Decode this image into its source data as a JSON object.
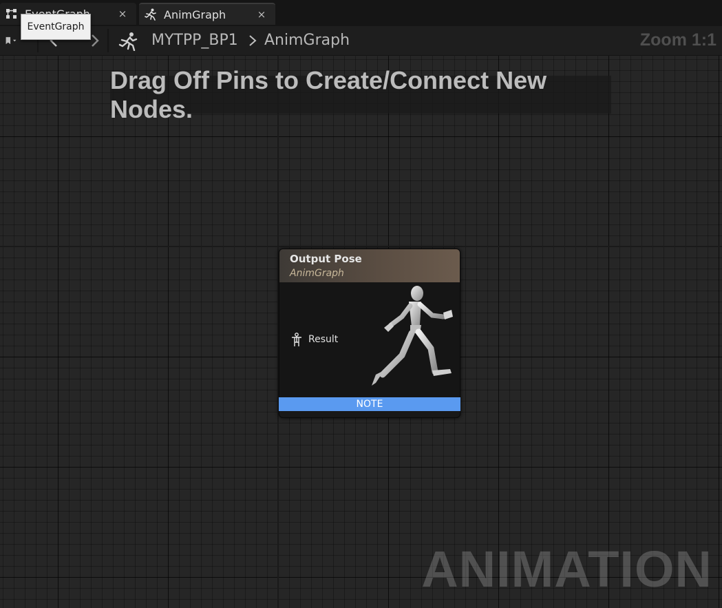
{
  "tabs": [
    {
      "label": "EventGraph",
      "icon": "event-graph-icon",
      "close": "×",
      "active": false
    },
    {
      "label": "AnimGraph",
      "icon": "running-figure-icon",
      "close": "×",
      "active": true
    }
  ],
  "tooltip": {
    "text": "EventGraph"
  },
  "toolbar": {
    "bookmark_icon": "bookmark-icon",
    "back_icon": "back-arrow-icon",
    "forward_icon": "forward-arrow-icon"
  },
  "breadcrumb": {
    "icon": "running-figure-icon",
    "root": "MYTPP_BP1",
    "leaf": "AnimGraph"
  },
  "zoom": {
    "label": "Zoom 1:1"
  },
  "hint": {
    "text": "Drag Off Pins to Create/Connect New Nodes."
  },
  "node": {
    "title": "Output Pose",
    "subtitle": "AnimGraph",
    "pin_label": "Result",
    "pin_icon": "pose-pin-icon",
    "preview_icon": "running-mannequin-icon",
    "footer": "NOTE",
    "header_color": "#5a4d42",
    "footer_color": "#5a9af0"
  },
  "watermark": {
    "text": "ANIMATION"
  }
}
